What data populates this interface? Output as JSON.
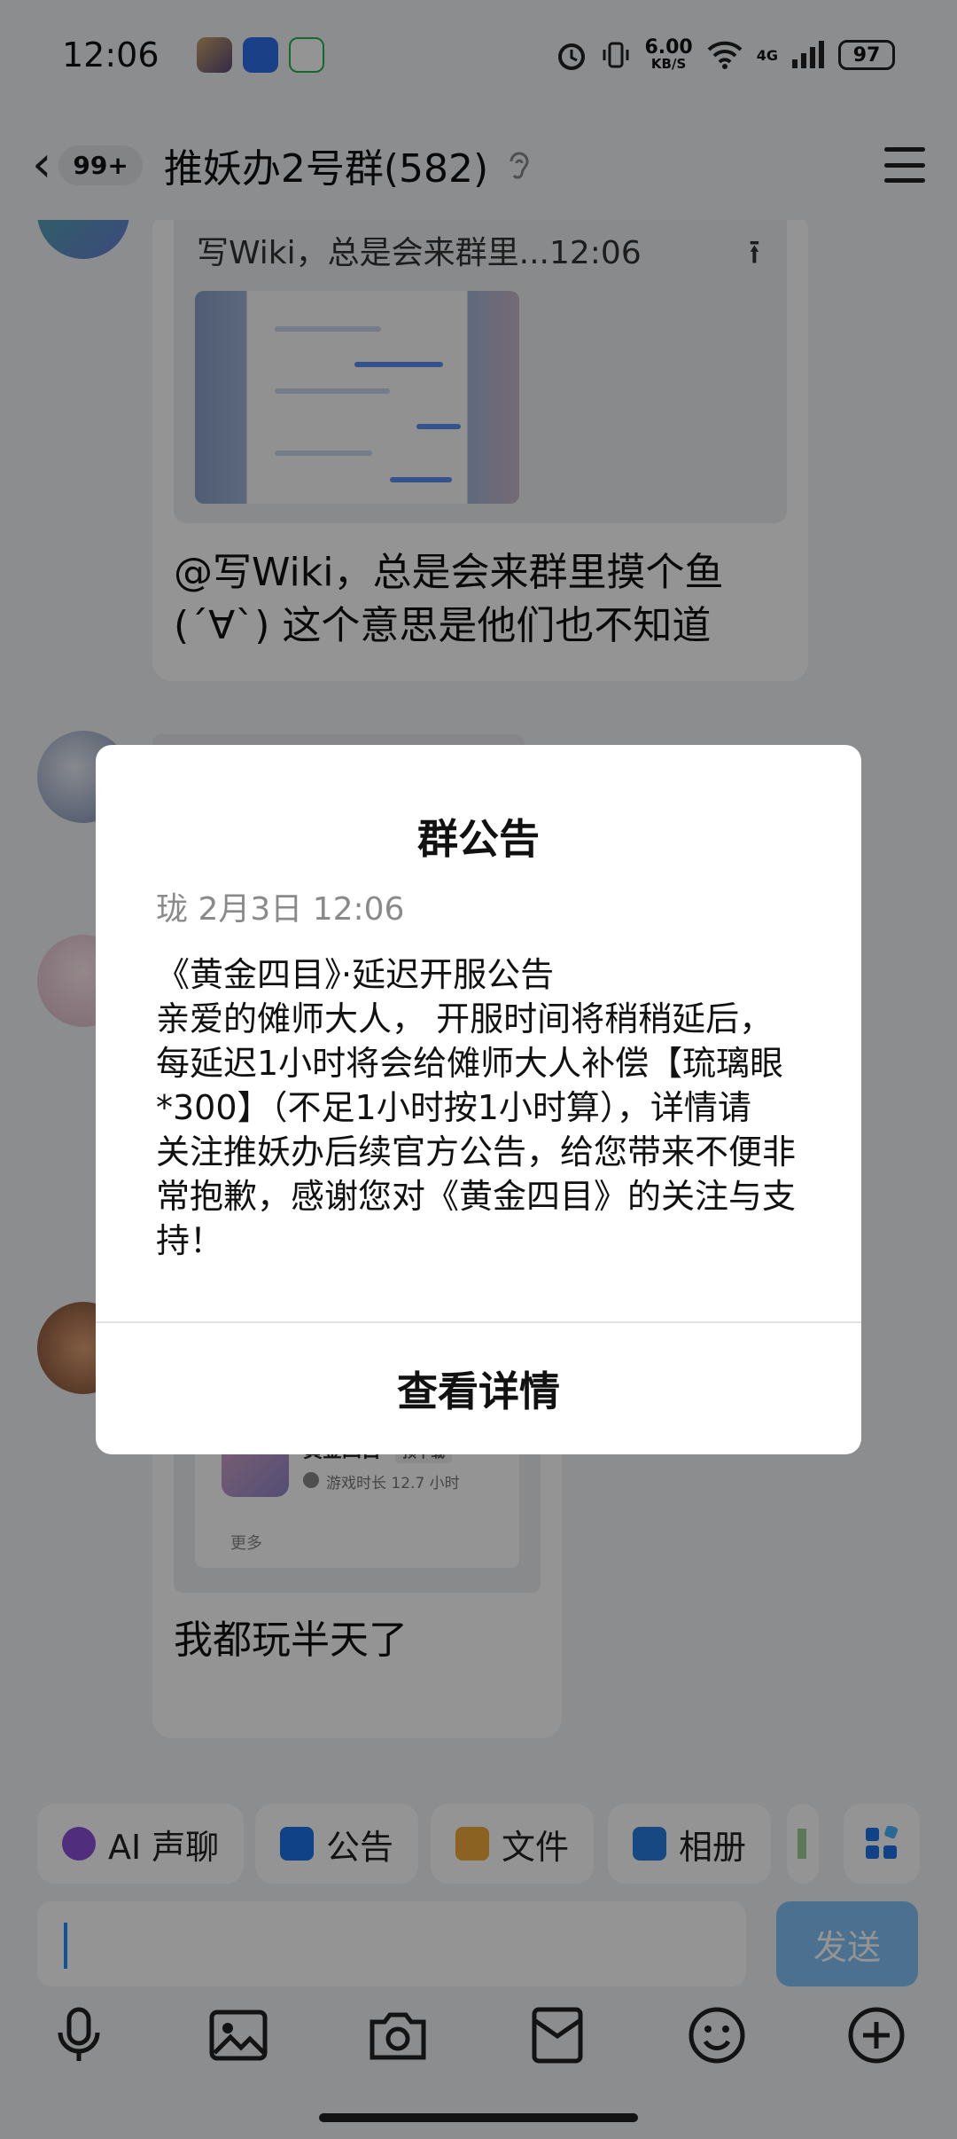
{
  "status_bar": {
    "time": "12:06",
    "net_speed_value": "6.00",
    "net_speed_unit": "KB/S",
    "signal_label": "4G",
    "battery": "97"
  },
  "header": {
    "unread_badge": "99+",
    "title": "推妖办2号群(582)"
  },
  "chat": {
    "quoted_header": "写Wiki，总是会来群里...12:06",
    "message_text": "@写Wiki，总是会来群里摸个鱼\n(´∀`) 这个意思是他们也不知道",
    "game_card": {
      "name": "黄金四目",
      "tag": "预下载",
      "playtime": "游戏时长 12.7 小时",
      "more": "更多"
    },
    "last_message": "我都玩半天了"
  },
  "toolbar": {
    "chips": [
      {
        "label": "AI 声聊",
        "icon": "ai-voice-icon",
        "color": "#8b4fd8"
      },
      {
        "label": "公告",
        "icon": "announcement-icon",
        "color": "#1a73e8"
      },
      {
        "label": "文件",
        "icon": "folder-icon",
        "color": "#f0a93b"
      },
      {
        "label": "相册",
        "icon": "album-icon",
        "color": "#2a7de1"
      }
    ],
    "send_label": "发送"
  },
  "modal": {
    "title": "群公告",
    "meta": "珑 2月3日 12:06",
    "body": "《黄金四目》·延迟开服公告\n亲爱的傩师大人， 开服时间将稍稍延后，\n每延迟1小时将会给傩师大人补偿【琉璃眼\n*300】（不足1小时按1小时算），详情请\n关注推妖办后续官方公告，给您带来不便非\n常抱歉，感谢您对《黄金四目》的关注与支\n持！",
    "button": "查看详情"
  }
}
